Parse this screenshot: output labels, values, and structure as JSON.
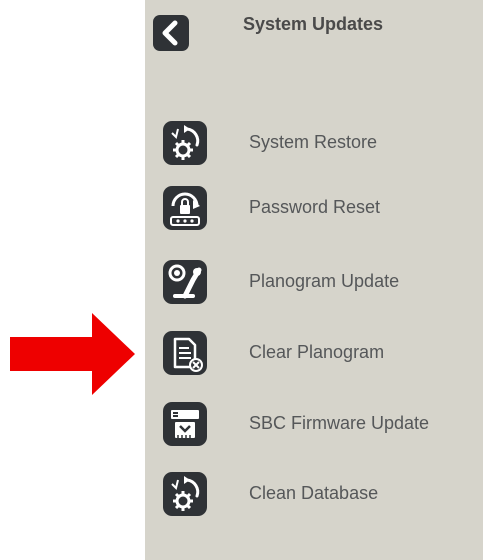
{
  "colors": {
    "panel_bg": "#d6d4cb",
    "icon_bg": "#2f3236",
    "label_text": "#555759",
    "title_text": "#4a4a4a",
    "arrow": "#ee0000"
  },
  "header": {
    "title": "System Updates",
    "back_icon": "chevron-left-icon"
  },
  "menu": {
    "items": [
      {
        "label": "System Restore",
        "icon": "gear-restore-icon"
      },
      {
        "label": "Password Reset",
        "icon": "padlock-reset-icon"
      },
      {
        "label": "Planogram Update",
        "icon": "planogram-update-icon"
      },
      {
        "label": "Clear Planogram",
        "icon": "document-clear-icon"
      },
      {
        "label": "SBC Firmware Update",
        "icon": "firmware-update-icon"
      },
      {
        "label": "Clean Database",
        "icon": "gear-restore-icon"
      }
    ]
  },
  "annotation": {
    "arrow_icon": "red-arrow-right-icon",
    "points_to": "Clear Planogram"
  }
}
